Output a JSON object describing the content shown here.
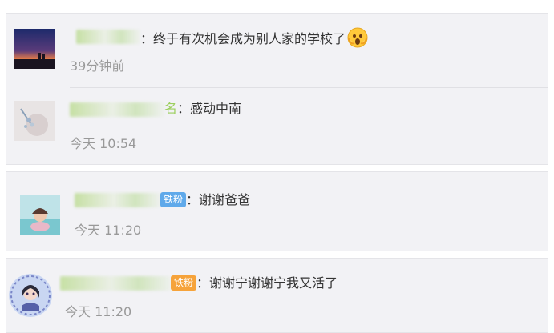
{
  "comments": [
    {
      "text": "终于有次机会成为别人家的学校了",
      "emoji": "shocked-face-emoji",
      "time": "39分钟前"
    },
    {
      "name_suffix": "名",
      "text": "感动中南",
      "time": "今天 10:54"
    },
    {
      "badge": "铁粉",
      "text": "谢谢爸爸",
      "time": "今天 11:20"
    },
    {
      "badge": "铁粉",
      "text": "谢谢宁谢谢宁我又活了",
      "time": "今天 11:20"
    }
  ],
  "separator": "："
}
